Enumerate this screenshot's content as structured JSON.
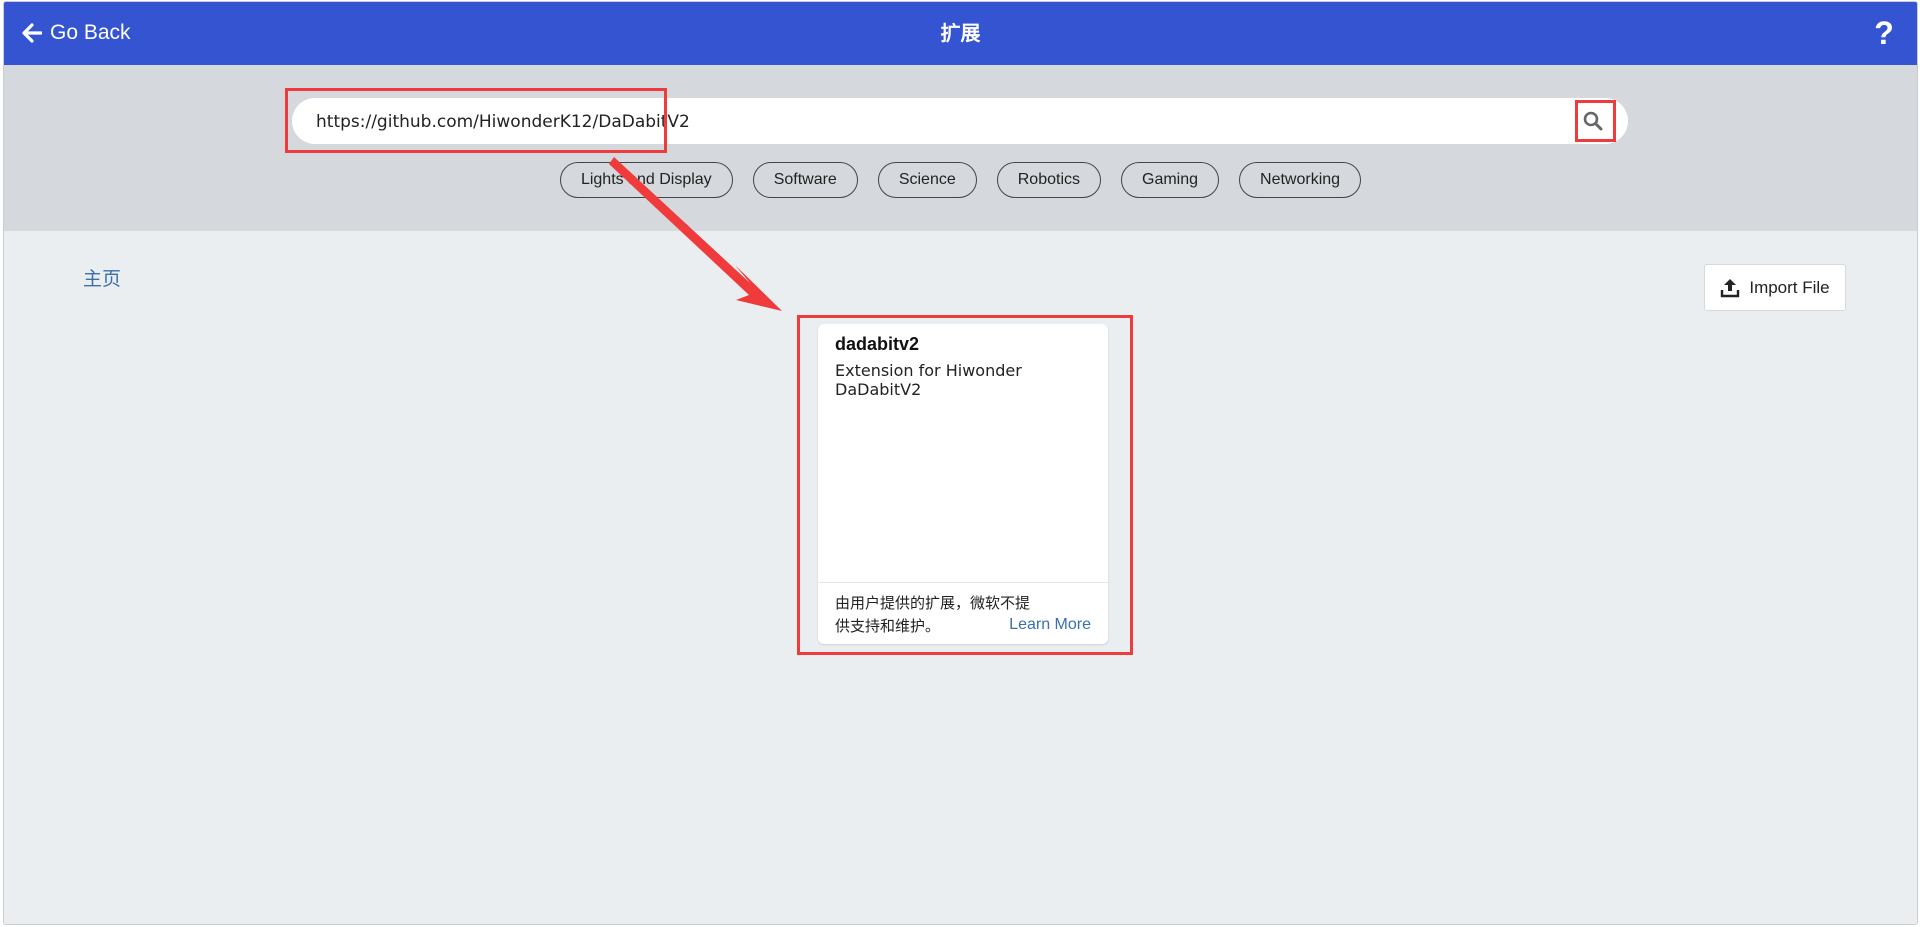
{
  "header": {
    "back_label": "Go Back",
    "title": "扩展",
    "help_label": "?"
  },
  "search": {
    "value": "https://github.com/HiwonderK12/DaDabitV2"
  },
  "categories": [
    "Lights and Display",
    "Software",
    "Science",
    "Robotics",
    "Gaming",
    "Networking"
  ],
  "breadcrumb": {
    "home": "主页"
  },
  "import_button": {
    "label": "Import File"
  },
  "result_card": {
    "title": "dadabitv2",
    "description": "Extension for Hiwonder DaDabitV2",
    "disclaimer": "由用户提供的扩展，微软不提供支持和维护。",
    "learn_more": "Learn More"
  },
  "colors": {
    "header_bg": "#3454d1",
    "search_band_bg": "#d5d9dd",
    "page_bg": "#ebeef0",
    "link": "#3a6fb0",
    "annotation": "#ef3b3b"
  },
  "icons": {
    "back": "arrow-left-icon",
    "search": "magnifier-icon",
    "import": "upload-icon"
  }
}
